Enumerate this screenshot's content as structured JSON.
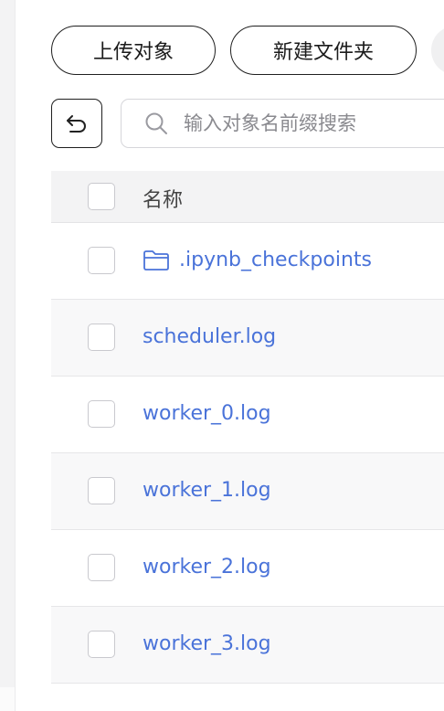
{
  "toolbar": {
    "upload_label": "上传对象",
    "new_folder_label": "新建文件夹"
  },
  "search": {
    "placeholder": "输入对象名前缀搜索"
  },
  "table": {
    "header": {
      "name": "名称"
    },
    "rows": [
      {
        "name": ".ipynb_checkpoints",
        "type": "folder",
        "icon": "folder-icon"
      },
      {
        "name": "scheduler.log",
        "type": "file"
      },
      {
        "name": "worker_0.log",
        "type": "file"
      },
      {
        "name": "worker_1.log",
        "type": "file"
      },
      {
        "name": "worker_2.log",
        "type": "file"
      },
      {
        "name": "worker_3.log",
        "type": "file"
      }
    ]
  },
  "colors": {
    "link": "#4a73d9",
    "header_bg": "#f3f3f4",
    "alt_row_bg": "#f8f8f9"
  }
}
